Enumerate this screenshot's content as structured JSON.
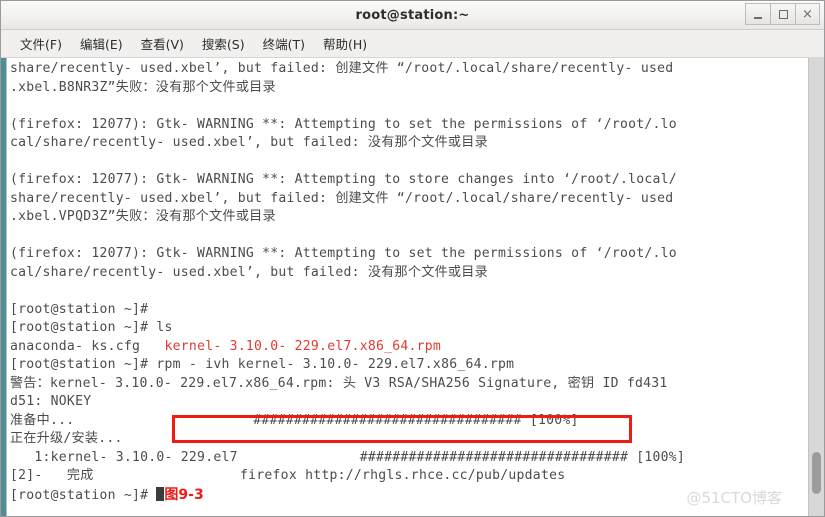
{
  "window": {
    "title": "root@station:~",
    "controls": [
      {
        "name": "minimize",
        "label": "_"
      },
      {
        "name": "maximize",
        "label": "□"
      },
      {
        "name": "close",
        "label": "×"
      }
    ]
  },
  "menubar": {
    "items": [
      {
        "label": "文件(F)"
      },
      {
        "label": "编辑(E)"
      },
      {
        "label": "查看(V)"
      },
      {
        "label": "搜索(S)"
      },
      {
        "label": "终端(T)"
      },
      {
        "label": "帮助(H)"
      }
    ]
  },
  "terminal": {
    "foreground_color": "#4c4c4c",
    "background_color": "#ffffff",
    "accent_red": "#e03b30",
    "lines": [
      "share/recently- used.xbel’, but failed: 创建文件 “/root/.local/share/recently- used",
      ".xbel.B8NR3Z”失败：没有那个文件或目录",
      "",
      "(firefox: 12077): Gtk- WARNING **: Attempting to set the permissions of ‘/root/.lo",
      "cal/share/recently- used.xbel’, but failed: 没有那个文件或目录",
      "",
      "(firefox: 12077): Gtk- WARNING **: Attempting to store changes into ‘/root/.local/",
      "share/recently- used.xbel’, but failed: 创建文件 “/root/.local/share/recently- used",
      ".xbel.VPQD3Z”失败：没有那个文件或目录",
      "",
      "(firefox: 12077): Gtk- WARNING **: Attempting to set the permissions of ‘/root/.lo",
      "cal/share/recently- used.xbel’, but failed: 没有那个文件或目录",
      "",
      "[root@station ~]#",
      "[root@station ~]# ls"
    ],
    "ls_line": {
      "plain": "anaconda- ks.cfg   ",
      "red": "kernel- 3.10.0- 229.el7.x86_64.rpm"
    },
    "command_line": {
      "prompt": "[root@station ~]# ",
      "command": "rpm - ivh kernel- 3.10.0- 229.el7.x86_64.rpm"
    },
    "tail_lines": [
      "警告：kernel- 3.10.0- 229.el7.x86_64.rpm: 头 V3 RSA/SHA256 Signature, 密钥 ID fd431",
      "d51: NOKEY",
      "准备中...                      ################################# [100%]",
      "正在升级/安装...",
      "   1:kernel- 3.10.0- 229.el7               ################################# [100%]",
      "[2]-   完成                  firefox http://rhgls.rhce.cc/pub/updates"
    ],
    "last_prompt": "[root@station ~]# ",
    "figure_label": "图9-3"
  },
  "watermark": {
    "text": "@51CTO博客"
  }
}
